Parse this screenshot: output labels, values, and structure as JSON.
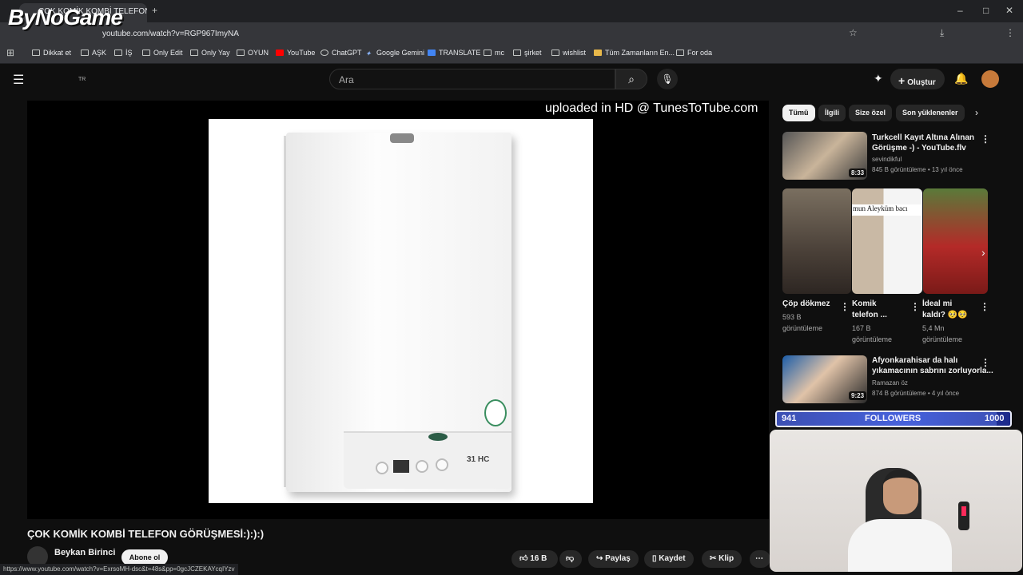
{
  "browser": {
    "tab_title": "ÇOK KOMİK KOMBİ TELEFON GÖRÜŞMESİ:):):)",
    "url": "youtube.com/watch?v=RGP967ImyNA",
    "bookmarks": [
      "Dikkat et",
      "AŞK",
      "İŞ",
      "Only Edit",
      "Only Yay",
      "OYUN",
      "YouTube",
      "ChatGPT",
      "Google Gemini",
      "TRANSLATE",
      "mc",
      "şirket",
      "wishlist",
      "Tüm Zamanların En...",
      "For oda"
    ],
    "status_url": "https://www.youtube.com/watch?v=ExrsoMH-dsc&t=48s&pp=0gcJCZEKAYcqIYzv"
  },
  "header": {
    "region": "TR",
    "search_placeholder": "Ara",
    "create_label": "Oluştur"
  },
  "player": {
    "watermark": "uploaded in HD @ TunesToTube.com",
    "boiler_model": "31 HC"
  },
  "video": {
    "title": "ÇOK KOMİK KOMBİ TELEFON GÖRÜŞMESİ:):):)",
    "channel": "Beykan Birinci",
    "subscribe": "Abone ol",
    "likes": "16 B",
    "share": "Paylaş",
    "save": "Kaydet",
    "clip": "Klip"
  },
  "chips": [
    "Tümü",
    "İlgili",
    "Size özel",
    "Son yüklenenler"
  ],
  "recs": [
    {
      "title_1": "Turkcell Kayıt Altına Alınan",
      "title_2": "Görüşme -) - YouTube.flv",
      "channel": "sevindikful",
      "meta": "845 B görüntüleme • 13 yıl önce",
      "duration": "8:33"
    },
    {
      "title_1": "Afyonkarahisar da halı",
      "title_2": "yıkamacının sabrını zorluyorla...",
      "channel": "Ramazan öz",
      "meta": "874 B görüntüleme • 4 yıl önce",
      "duration": "9:23"
    }
  ],
  "shorts": [
    {
      "title_1": "Çöp dökmez",
      "title_2": "",
      "views_1": "593 B",
      "views_2": "görüntüleme"
    },
    {
      "title_1": "Komik",
      "title_2": "telefon ...",
      "views_1": "167 B",
      "views_2": "görüntüleme",
      "overlay": "mun Aleyküm bacı"
    },
    {
      "title_1": "İdeal mi",
      "title_2": "kaldı? 🥺🥺",
      "views_1": "5,4 Mn",
      "views_2": "görüntüleme"
    }
  ],
  "overlay": {
    "logo": "ByNoGame",
    "followers_current": "941",
    "followers_label": "FOLLOWERS",
    "followers_goal": "1000",
    "followers_progress": 0.941
  },
  "colors": {
    "bg": "#0f0f0f",
    "accent": "#f1f1f1",
    "followers_bar": "#2c46c9"
  },
  "icons": [
    "menu-icon",
    "search-icon",
    "mic-icon",
    "plus-icon",
    "bell-icon",
    "like-icon",
    "dislike-icon",
    "share-icon",
    "save-icon",
    "clip-icon",
    "more-icon",
    "chevron-right-icon"
  ]
}
